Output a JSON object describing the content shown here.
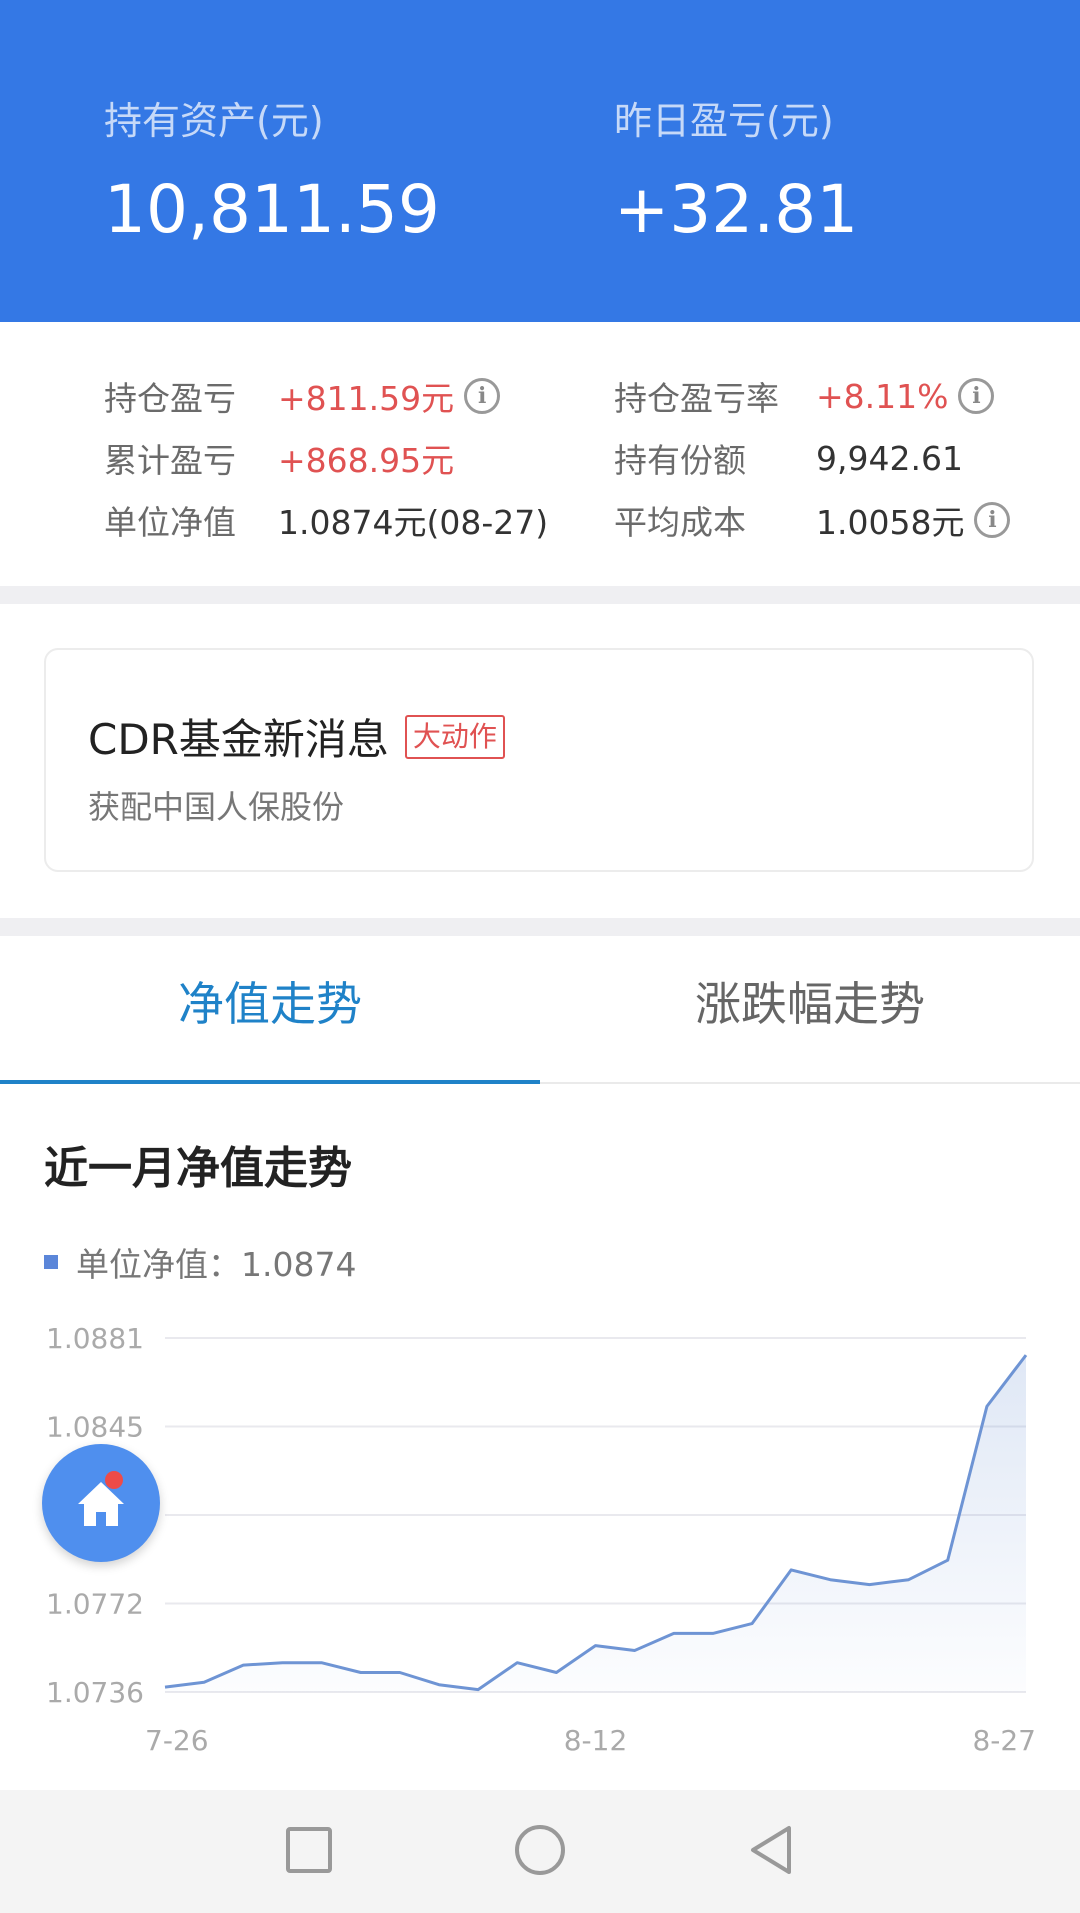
{
  "header": {
    "holding_assets_label": "持有资产(元)",
    "holding_assets_value": "10,811.59",
    "yesterday_pnl_label": "昨日盈亏(元)",
    "yesterday_pnl_value": "+32.81",
    "bg_color": "#3478e5"
  },
  "stats": {
    "position_pnl": {
      "label": "持仓盈亏",
      "value": "+811.59元"
    },
    "position_pnl_rate": {
      "label": "持仓盈亏率",
      "value": "+8.11%"
    },
    "cumulative_pnl": {
      "label": "累计盈亏",
      "value": "+868.95元"
    },
    "holding_shares": {
      "label": "持有份额",
      "value": "9,942.61"
    },
    "unit_nav": {
      "label": "单位净值",
      "value": "1.0874元(08-27)"
    },
    "average_cost": {
      "label": "平均成本",
      "value": "1.0058元"
    },
    "info_icon": "i"
  },
  "news_card": {
    "title": "CDR基金新消息",
    "tag": "大动作",
    "subtitle": "获配中国人保股份"
  },
  "tabs": [
    {
      "label": "净值走势",
      "active": true
    },
    {
      "label": "涨跌幅走势",
      "active": false
    }
  ],
  "chart_section": {
    "title": "近一月净值走势",
    "legend": "单位净值：1.0874"
  },
  "chart_data": {
    "type": "area",
    "series": [
      {
        "name": "单位净值",
        "values": [
          1.0738,
          1.074,
          1.0747,
          1.0748,
          1.0748,
          1.0744,
          1.0744,
          1.0739,
          1.0737,
          1.0748,
          1.0744,
          1.0755,
          1.0753,
          1.076,
          1.076,
          1.0764,
          1.0786,
          1.0782,
          1.078,
          1.0782,
          1.079,
          1.0853,
          1.0874
        ]
      }
    ],
    "y_ticks": [
      "1.0881",
      "1.0845",
      "",
      "1.0772",
      "1.0736"
    ],
    "ylim": [
      1.0736,
      1.0881
    ],
    "x_ticks": [
      "7-26",
      "8-12",
      "8-27"
    ],
    "grid": true,
    "line_color": "#6e94d4"
  },
  "fab": {
    "icon": "home-icon",
    "badge_color": "#ee4b48"
  },
  "navbar": {
    "icons": [
      "square-icon",
      "circle-icon",
      "back-triangle-icon"
    ]
  }
}
